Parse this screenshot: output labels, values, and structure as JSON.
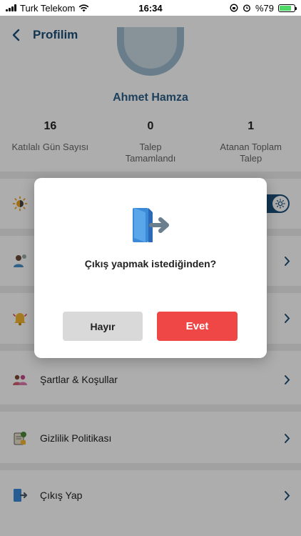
{
  "status_bar": {
    "carrier": "Turk Telekom",
    "time": "16:34",
    "battery_text": "%79",
    "battery_level": 0.79
  },
  "nav": {
    "title": "Profilim",
    "back_icon": "chevron-left-icon"
  },
  "profile": {
    "name": "Ahmet Hamza",
    "stats": [
      {
        "value": "16",
        "label_line1": "Katılalı Gün Sayısı",
        "label_line2": ""
      },
      {
        "value": "0",
        "label_line1": "Talep",
        "label_line2": "Tamamlandı"
      },
      {
        "value": "1",
        "label_line1": "Atanan Toplam",
        "label_line2": "Talep"
      }
    ]
  },
  "menu": {
    "items": [
      {
        "label": "Şartlar & Koşullar",
        "icon": "people-icon"
      },
      {
        "label": "Gizlilik Politikası",
        "icon": "privacy-doc-icon"
      },
      {
        "label": "Çıkış Yap",
        "icon": "logout-icon"
      }
    ]
  },
  "dialog": {
    "message": "Çıkış yapmak istediğinden?",
    "cancel_label": "Hayır",
    "confirm_label": "Evet",
    "icon": "exit-door-icon"
  },
  "colors": {
    "primary": "#1b4f7a",
    "name_blue": "#2b5f89",
    "danger": "#ef4646",
    "cancel_gray": "#d9d9d9"
  }
}
